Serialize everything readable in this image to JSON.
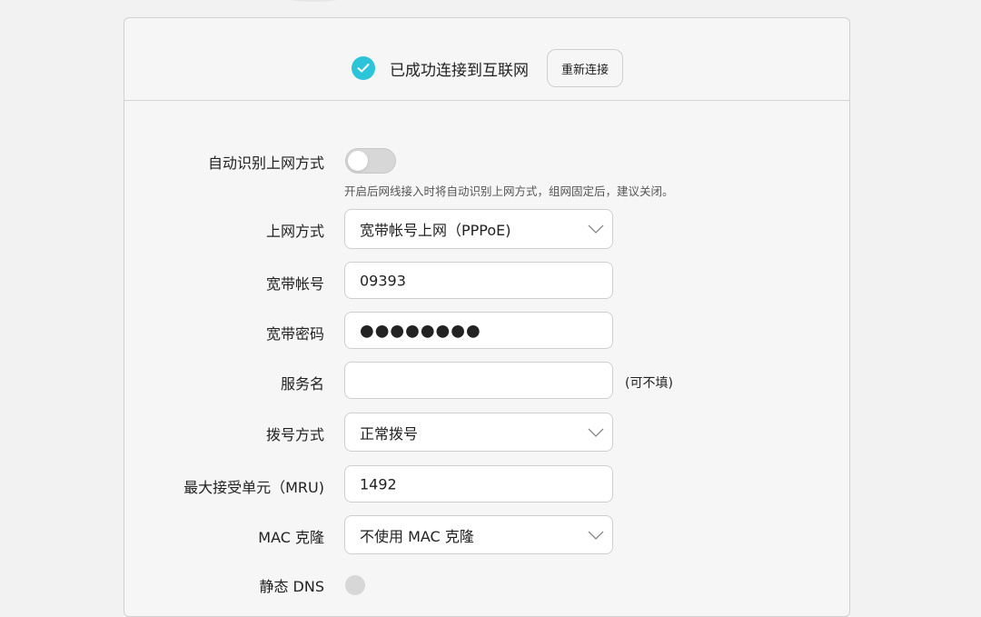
{
  "status": {
    "text": "已成功连接到互联网",
    "reconnect_label": "重新连接",
    "accent_color": "#2bc4d8"
  },
  "auto_detect": {
    "label": "自动识别上网方式",
    "enabled": false,
    "hint": "开启后网线接入时将自动识别上网方式，组网固定后，建议关闭。"
  },
  "connection_type": {
    "label": "上网方式",
    "value": "宽带帐号上网（PPPoE)"
  },
  "account": {
    "label": "宽带帐号",
    "value": "09393"
  },
  "password": {
    "label": "宽带密码",
    "value": "●●●●●●●●"
  },
  "service_name": {
    "label": "服务名",
    "value": "",
    "suffix": "(可不填)"
  },
  "dial_mode": {
    "label": "拨号方式",
    "value": "正常拨号"
  },
  "mru": {
    "label": "最大接受单元（MRU)",
    "value": "1492"
  },
  "mac_clone": {
    "label": "MAC 克隆",
    "value": "不使用 MAC 克隆"
  },
  "static_dns": {
    "label": "静态 DNS"
  }
}
